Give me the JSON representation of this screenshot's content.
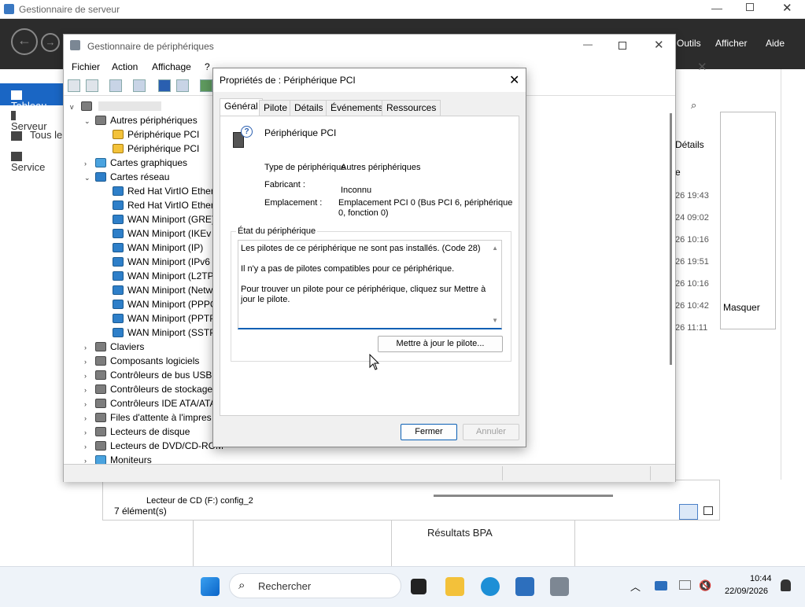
{
  "server_manager": {
    "title": "Gestionnaire de serveur",
    "menu": [
      "Outils",
      "Afficher",
      "Aide"
    ],
    "left_nav": [
      "Tableau",
      "Serveur",
      "Tous le",
      "Service"
    ],
    "bg_right": {
      "details": "Détails",
      "e_label": "e",
      "dates": [
        "26 19:43",
        "24 09:02",
        "26 10:16",
        "26 19:51",
        "26 10:16",
        "26 10:42",
        "26 11:11"
      ],
      "masquer": "Masquer"
    },
    "bottom": {
      "row": "Lecteur de CD (F:) config_2",
      "count": "7 élément(s)",
      "bpa": "Résultats BPA"
    }
  },
  "device_manager": {
    "title": "Gestionnaire de périphériques",
    "menu": [
      "Fichier",
      "Action",
      "Affichage",
      "?"
    ],
    "tree": [
      {
        "label": "Autres périphériques",
        "exp": "v",
        "icon": "gen",
        "level": 1
      },
      {
        "label": "Périphérique PCI",
        "exp": "",
        "icon": "warn",
        "level": 2
      },
      {
        "label": "Périphérique PCI",
        "exp": "",
        "icon": "warn",
        "level": 2
      },
      {
        "label": "Cartes graphiques",
        "exp": ">",
        "icon": "disp",
        "level": 1
      },
      {
        "label": "Cartes réseau",
        "exp": "v",
        "icon": "net",
        "level": 1
      },
      {
        "label": "Red Hat VirtIO Ethern",
        "exp": "",
        "icon": "net",
        "level": 2
      },
      {
        "label": "Red Hat VirtIO Ethern",
        "exp": "",
        "icon": "net",
        "level": 2
      },
      {
        "label": "WAN Miniport (GRE)",
        "exp": "",
        "icon": "net",
        "level": 2
      },
      {
        "label": "WAN Miniport (IKEv",
        "exp": "",
        "icon": "net",
        "level": 2
      },
      {
        "label": "WAN Miniport (IP)",
        "exp": "",
        "icon": "net",
        "level": 2
      },
      {
        "label": "WAN Miniport (IPv6",
        "exp": "",
        "icon": "net",
        "level": 2
      },
      {
        "label": "WAN Miniport (L2TP",
        "exp": "",
        "icon": "net",
        "level": 2
      },
      {
        "label": "WAN Miniport (Netw",
        "exp": "",
        "icon": "net",
        "level": 2
      },
      {
        "label": "WAN Miniport (PPPC",
        "exp": "",
        "icon": "net",
        "level": 2
      },
      {
        "label": "WAN Miniport (PPTP",
        "exp": "",
        "icon": "net",
        "level": 2
      },
      {
        "label": "WAN Miniport (SSTP",
        "exp": "",
        "icon": "net",
        "level": 2
      },
      {
        "label": "Claviers",
        "exp": ">",
        "icon": "gen",
        "level": 1
      },
      {
        "label": "Composants logiciels",
        "exp": ">",
        "icon": "gen",
        "level": 1
      },
      {
        "label": "Contrôleurs de bus USB",
        "exp": ">",
        "icon": "gen",
        "level": 1
      },
      {
        "label": "Contrôleurs de stockage",
        "exp": ">",
        "icon": "gen",
        "level": 1
      },
      {
        "label": "Contrôleurs IDE ATA/ATA",
        "exp": ">",
        "icon": "gen",
        "level": 1
      },
      {
        "label": "Files d'attente à l'impres",
        "exp": ">",
        "icon": "gen",
        "level": 1
      },
      {
        "label": "Lecteurs de disque",
        "exp": ">",
        "icon": "gen",
        "level": 1
      },
      {
        "label": "Lecteurs de DVD/CD-ROM",
        "exp": ">",
        "icon": "gen",
        "level": 1
      },
      {
        "label": "Moniteurs",
        "exp": ">",
        "icon": "disp",
        "level": 1
      }
    ]
  },
  "dialog": {
    "title": "Propriétés de : Périphérique PCI",
    "tabs": [
      "Général",
      "Pilote",
      "Détails",
      "Événements",
      "Ressources"
    ],
    "device_name": "Périphérique PCI",
    "type_label": "Type de périphérique",
    "type_value": "Autres périphériques",
    "maker_label": "Fabricant :",
    "maker_value": "Inconnu",
    "location_label": "Emplacement :",
    "location_value_1": "Emplacement PCI 0 (Bus PCI 6, périphérique",
    "location_value_2": "0, fonction 0)",
    "status_legend": "État du périphérique",
    "status_lines": [
      "Les pilotes de ce périphérique ne sont pas installés. (Code 28)",
      "Il n'y a pas de pilotes compatibles pour ce périphérique.",
      "Pour trouver un pilote pour ce périphérique, cliquez sur Mettre à jour le pilote."
    ],
    "update_button": "Mettre à jour le pilote...",
    "close_button": "Fermer",
    "cancel_button": "Annuler"
  },
  "taskbar": {
    "search_placeholder": "Rechercher",
    "time": "10:44",
    "date": "22/09/2026"
  }
}
